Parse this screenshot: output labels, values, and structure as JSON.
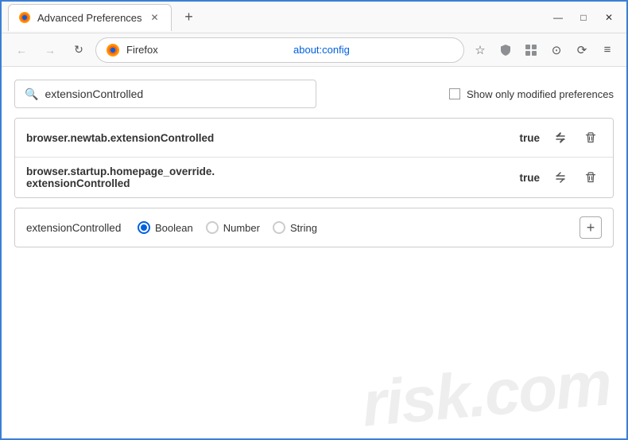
{
  "titleBar": {
    "tabTitle": "Advanced Preferences",
    "newTabIcon": "+",
    "windowControls": {
      "minimize": "—",
      "maximize": "□",
      "close": "✕"
    }
  },
  "navBar": {
    "back": "←",
    "forward": "→",
    "reload": "↻",
    "browserName": "Firefox",
    "addressText": "about:config",
    "starIcon": "☆",
    "shieldIcon": "⛉",
    "extensionIcon": "⊞",
    "profileIcon": "⊙",
    "syncIcon": "⟳",
    "menuIcon": "≡"
  },
  "search": {
    "placeholder": "",
    "value": "extensionControlled",
    "searchIconLabel": "search",
    "showModifiedLabel": "Show only modified preferences"
  },
  "preferences": [
    {
      "name": "browser.newtab.extensionControlled",
      "value": "true"
    },
    {
      "name1": "browser.startup.homepage_override.",
      "name2": "extensionControlled",
      "value": "true"
    }
  ],
  "addRow": {
    "name": "extensionControlled",
    "types": [
      {
        "label": "Boolean",
        "selected": true
      },
      {
        "label": "Number",
        "selected": false
      },
      {
        "label": "String",
        "selected": false
      }
    ],
    "addBtnLabel": "+"
  },
  "watermark": {
    "line1": "risk.com"
  }
}
